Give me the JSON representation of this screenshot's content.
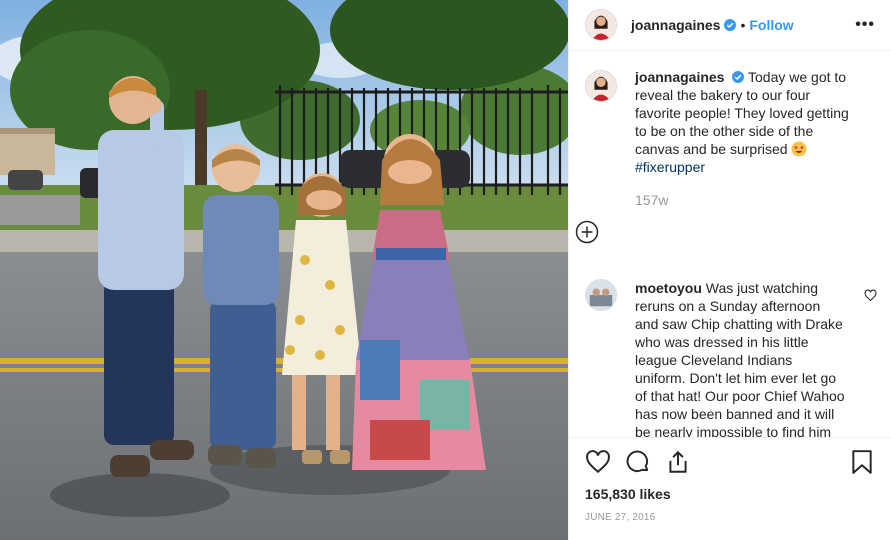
{
  "post": {
    "username": "joannagaines",
    "follow_label": "Follow",
    "separator": "•",
    "more_label": "•••",
    "caption": {
      "username": "joannagaines",
      "text": "Today we got to reveal the bakery to our four favorite people! They loved getting to be on the other side of the canvas and be surprised",
      "hashtag": "#fixerupper"
    },
    "timestamp_relative": "157w",
    "comments": [
      {
        "username": "moetoyou",
        "text": "Was just watching reruns on a Sunday afternoon and saw Chip chatting with Drake who was dressed in his little league Cleveland Indians uniform. Don't let him ever let go of that hat! Our poor Chief Wahoo has now been banned and it will be nearly impossible to find him anywhere!"
      }
    ],
    "likes": "165,830 likes",
    "date": "June 27, 2016"
  },
  "icons": {
    "verified": "verified-badge-icon",
    "more": "more-options-icon",
    "load_more": "plus-circle-icon",
    "like": "heart-icon",
    "comment": "comment-icon",
    "share": "share-icon",
    "save": "bookmark-icon",
    "emoji": "star-struck-emoji-icon"
  },
  "colors": {
    "link_blue": "#3897f0",
    "hashtag": "#003569",
    "verified": "#3897f0",
    "muted": "#999999",
    "text": "#262626"
  }
}
